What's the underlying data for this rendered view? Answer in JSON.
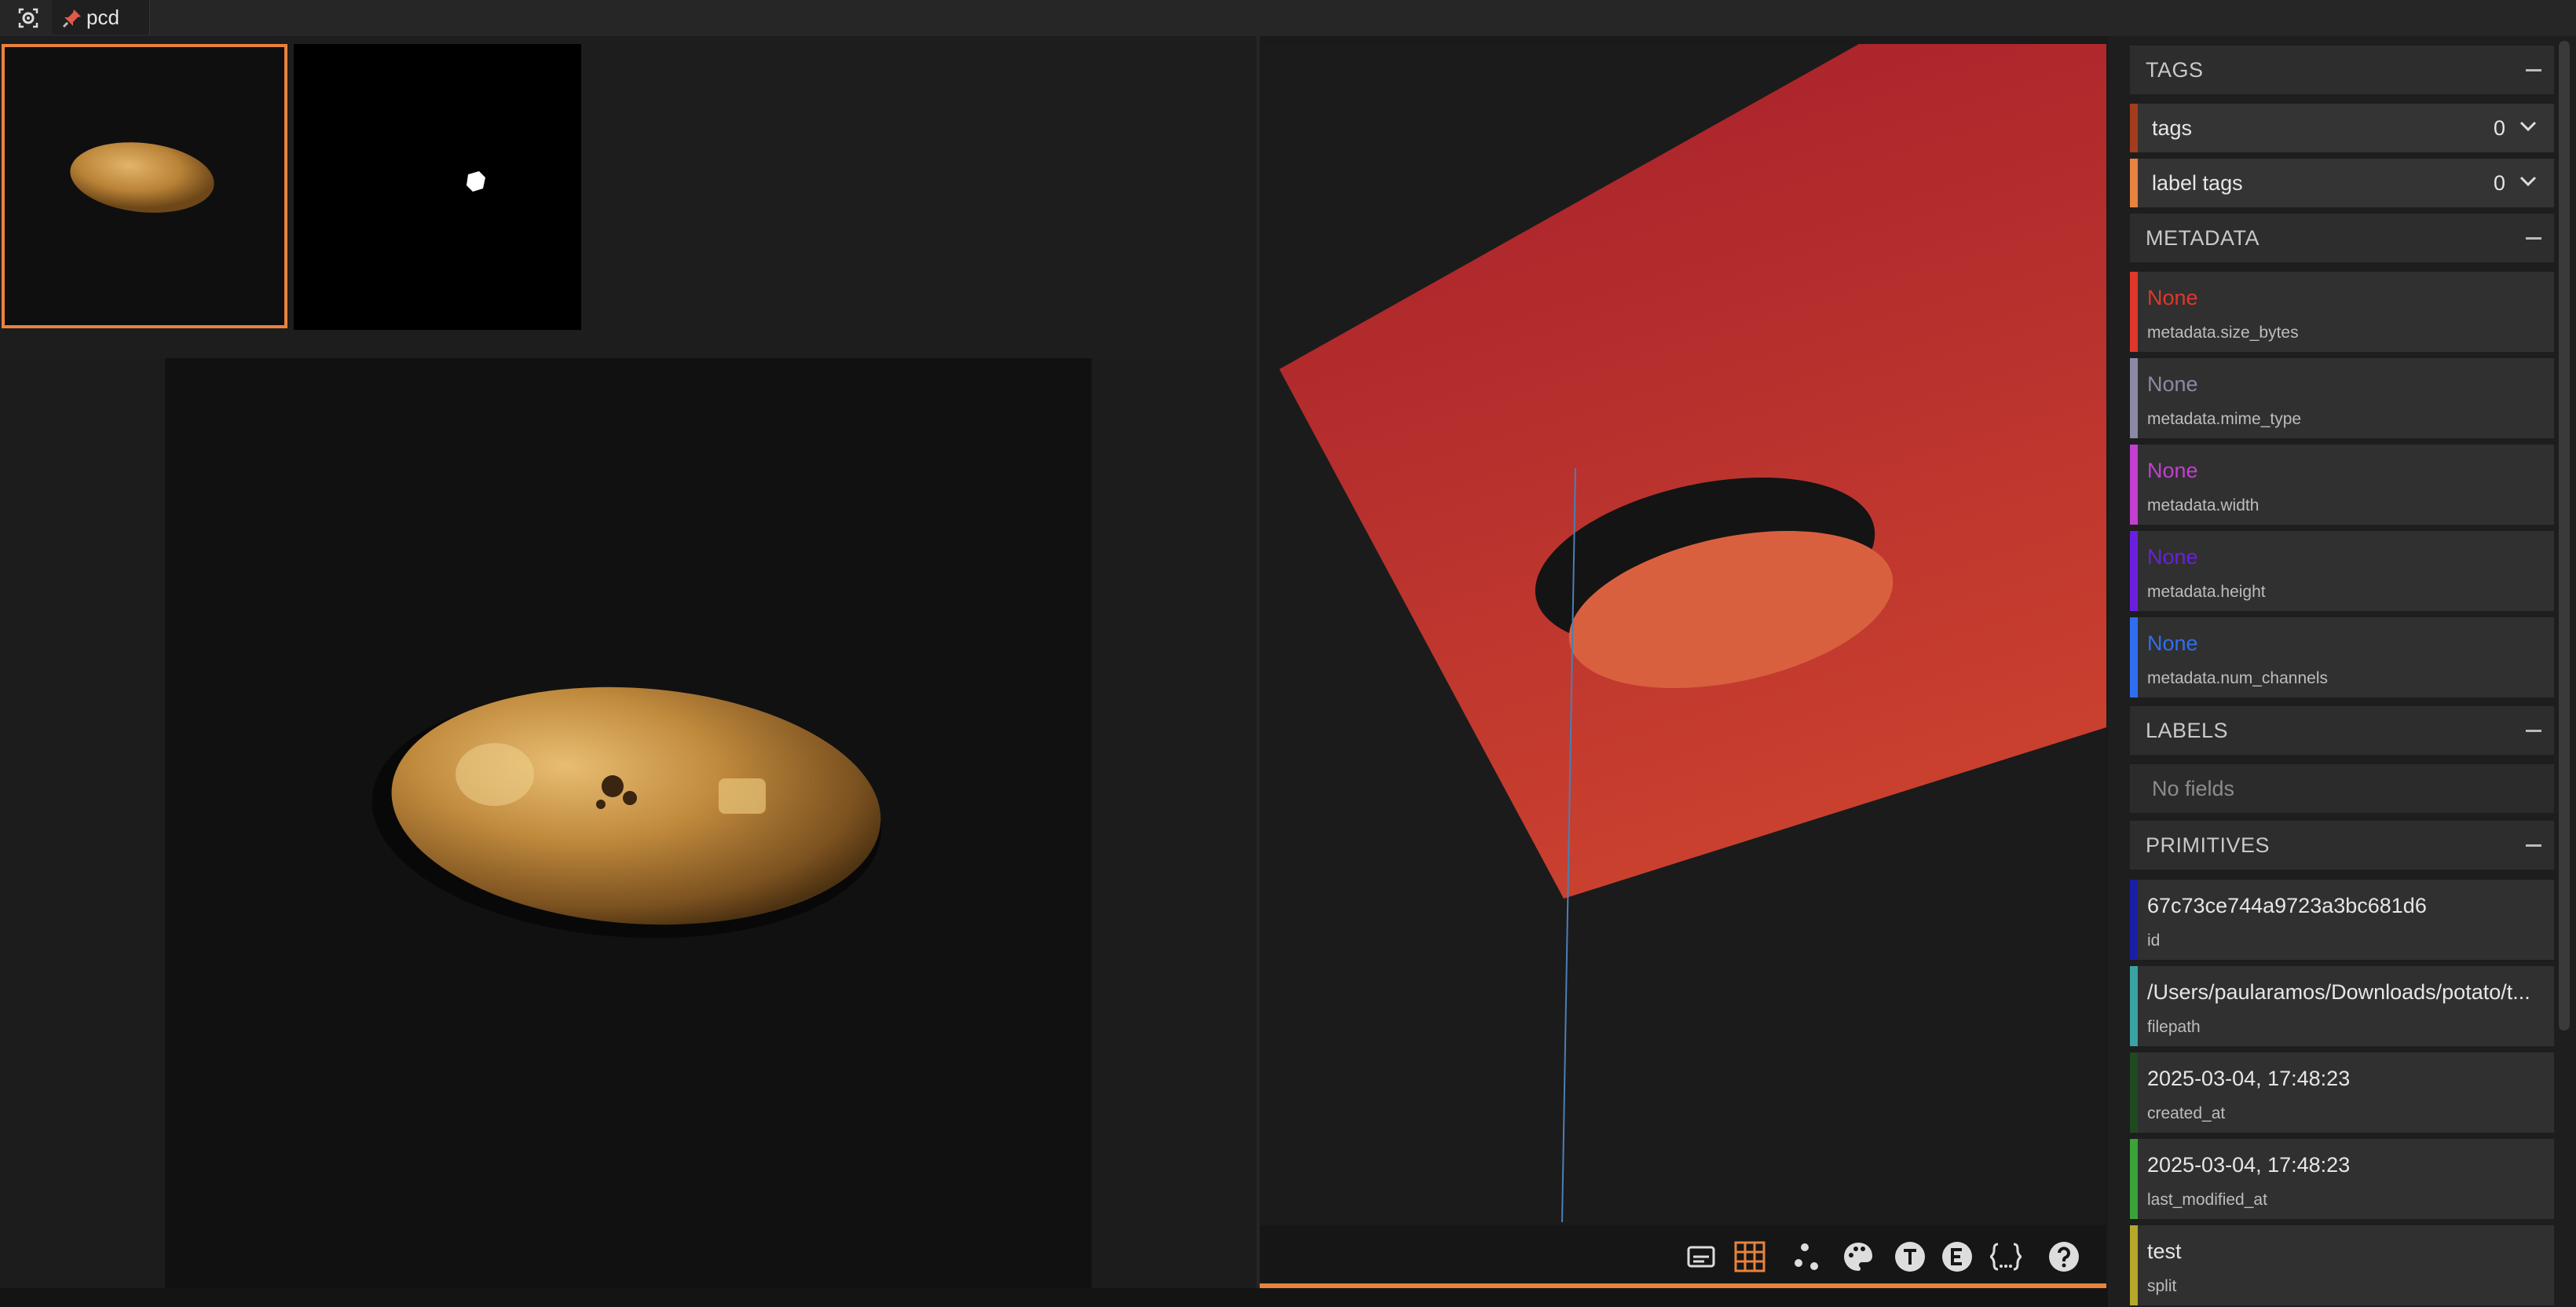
{
  "app": {
    "tab_label": "pcd"
  },
  "sidebar": {
    "sections": {
      "tags": "TAGS",
      "metadata": "METADATA",
      "labels": "LABELS",
      "primitives": "PRIMITIVES"
    },
    "tags": [
      {
        "label": "tags",
        "count": "0",
        "color": "#a23c1d"
      },
      {
        "label": "label tags",
        "count": "0",
        "color": "#e8823f"
      }
    ],
    "metadata": [
      {
        "value": "None",
        "key": "metadata.size_bytes",
        "color": "#e0372b"
      },
      {
        "value": "None",
        "key": "metadata.mime_type",
        "color": "#8a8aa6"
      },
      {
        "value": "None",
        "key": "metadata.width",
        "color": "#c23fd1"
      },
      {
        "value": "None",
        "key": "metadata.height",
        "color": "#6a1fe0"
      },
      {
        "value": "None",
        "key": "metadata.num_channels",
        "color": "#2f6ef0"
      }
    ],
    "labels_empty": "No fields",
    "primitives": [
      {
        "value": "67c73ce744a9723a3bc681d6",
        "key": "id",
        "color": "#1a1fa6"
      },
      {
        "value": "/Users/paularamos/Downloads/potato/t...",
        "key": "filepath",
        "color": "#3aa3a3"
      },
      {
        "value": "2025-03-04, 17:48:23",
        "key": "created_at",
        "color": "#1f4a1f"
      },
      {
        "value": "2025-03-04, 17:48:23",
        "key": "last_modified_at",
        "color": "#3aa33a"
      },
      {
        "value": "test",
        "key": "split",
        "color": "#b5a82a"
      }
    ]
  },
  "pcd_toolbar": {
    "icons": [
      "caption-icon",
      "grid-icon",
      "points-icon",
      "palette-icon",
      "t-icon",
      "e-icon",
      "json-icon",
      "help-icon"
    ]
  }
}
